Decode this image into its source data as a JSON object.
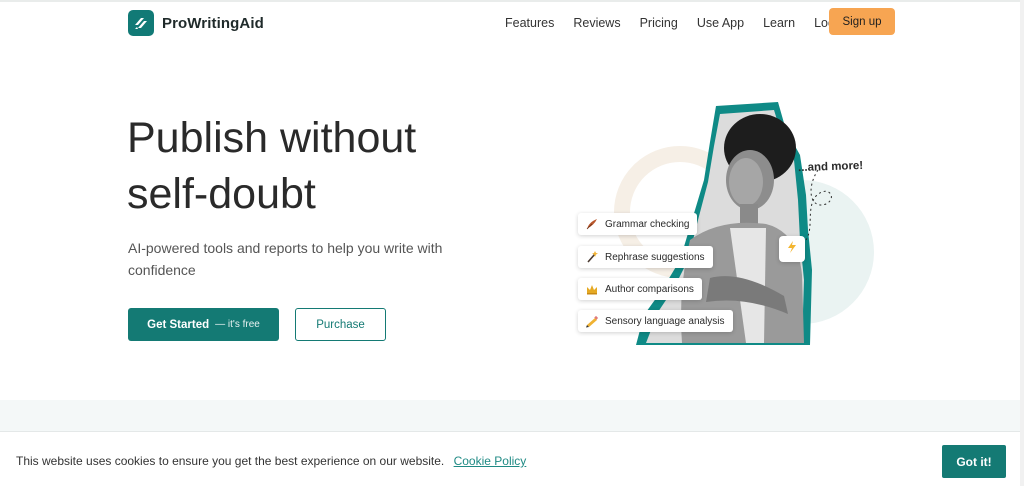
{
  "header": {
    "brand": "ProWritingAid",
    "nav": [
      "Features",
      "Reviews",
      "Pricing",
      "Use App",
      "Learn",
      "Log in"
    ],
    "signup_label": "Sign up"
  },
  "hero": {
    "title_line1": "Publish without",
    "title_line2": "self-doubt",
    "subtitle": "AI-powered tools and reports to help you write with confidence",
    "primary_label": "Get Started",
    "primary_aux": "— it's free",
    "secondary_label": "Purchase"
  },
  "illustration": {
    "more_text": "...and more!",
    "features": [
      {
        "label": "Grammar checking",
        "icon": "quill-icon"
      },
      {
        "label": "Rephrase suggestions",
        "icon": "magic-wand-icon"
      },
      {
        "label": "Author comparisons",
        "icon": "crown-icon"
      },
      {
        "label": "Sensory language analysis",
        "icon": "pencil-icon"
      }
    ],
    "accent_icon": "lightning-icon"
  },
  "cookie": {
    "message": "This website uses cookies to ensure you get the best experience on our website.",
    "link_label": "Cookie Policy",
    "button_label": "Got it!"
  },
  "colors": {
    "brand_teal": "#147a74",
    "signup_orange": "#f7a552",
    "hero_ring": "#eaf3f2"
  }
}
